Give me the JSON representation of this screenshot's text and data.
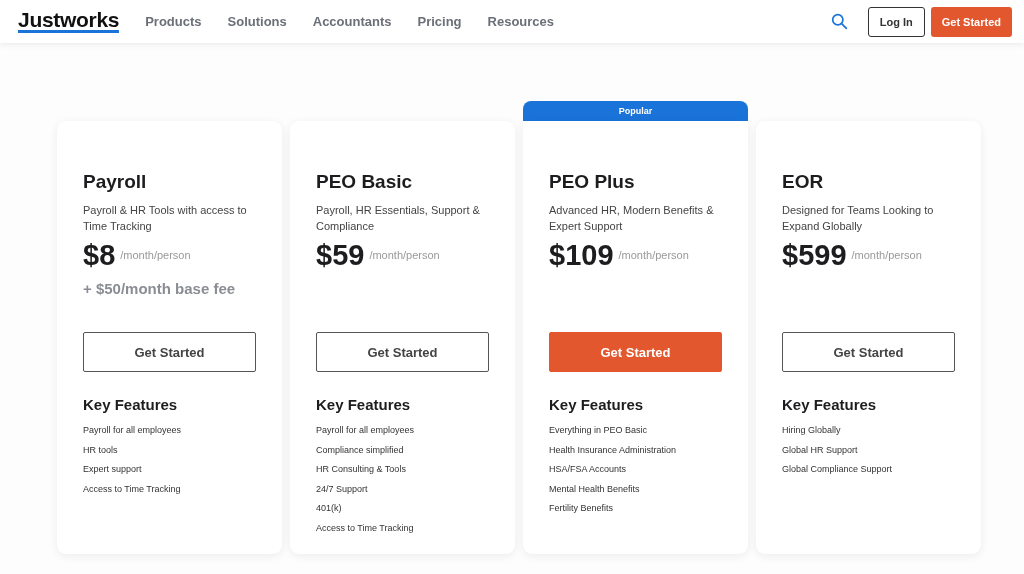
{
  "header": {
    "logo": "Justworks",
    "nav": [
      "Products",
      "Solutions",
      "Accountants",
      "Pricing",
      "Resources"
    ],
    "login": "Log In",
    "cta": "Get Started"
  },
  "plans": [
    {
      "name": "Payroll",
      "description": "Payroll & HR Tools with access to Time Tracking",
      "price": "$8",
      "unit": "/month/person",
      "extra": "+ $50/month base fee",
      "button": {
        "label": "Get Started",
        "primary": false
      },
      "features_title": "Key Features",
      "features": [
        "Payroll for all employees",
        "HR tools",
        "Expert support",
        "Access to Time Tracking"
      ]
    },
    {
      "name": "PEO Basic",
      "description": "Payroll, HR Essentials, Support & Compliance",
      "price": "$59",
      "unit": "/month/person",
      "button": {
        "label": "Get Started",
        "primary": false
      },
      "features_title": "Key Features",
      "features": [
        "Payroll for all employees",
        "Compliance simplified",
        "HR Consulting & Tools",
        "24/7 Support",
        "401(k)",
        "Access to Time Tracking"
      ]
    },
    {
      "name": "PEO Plus",
      "badge": "Popular",
      "description": "Advanced HR, Modern Benefits & Expert Support",
      "price": "$109",
      "unit": "/month/person",
      "button": {
        "label": "Get Started",
        "primary": true
      },
      "features_title": "Key Features",
      "features": [
        "Everything in PEO Basic",
        "Health Insurance Administration",
        "HSA/FSA Accounts",
        "Mental Health Benefits",
        "Fertility Benefits"
      ]
    },
    {
      "name": "EOR",
      "description": "Designed for Teams Looking to Expand Globally",
      "price": "$599",
      "unit": "/month/person",
      "button": {
        "label": "Get Started",
        "primary": false
      },
      "features_title": "Key Features",
      "features": [
        "Hiring Globally",
        "Global HR Support",
        "Global Compliance Support"
      ]
    }
  ]
}
